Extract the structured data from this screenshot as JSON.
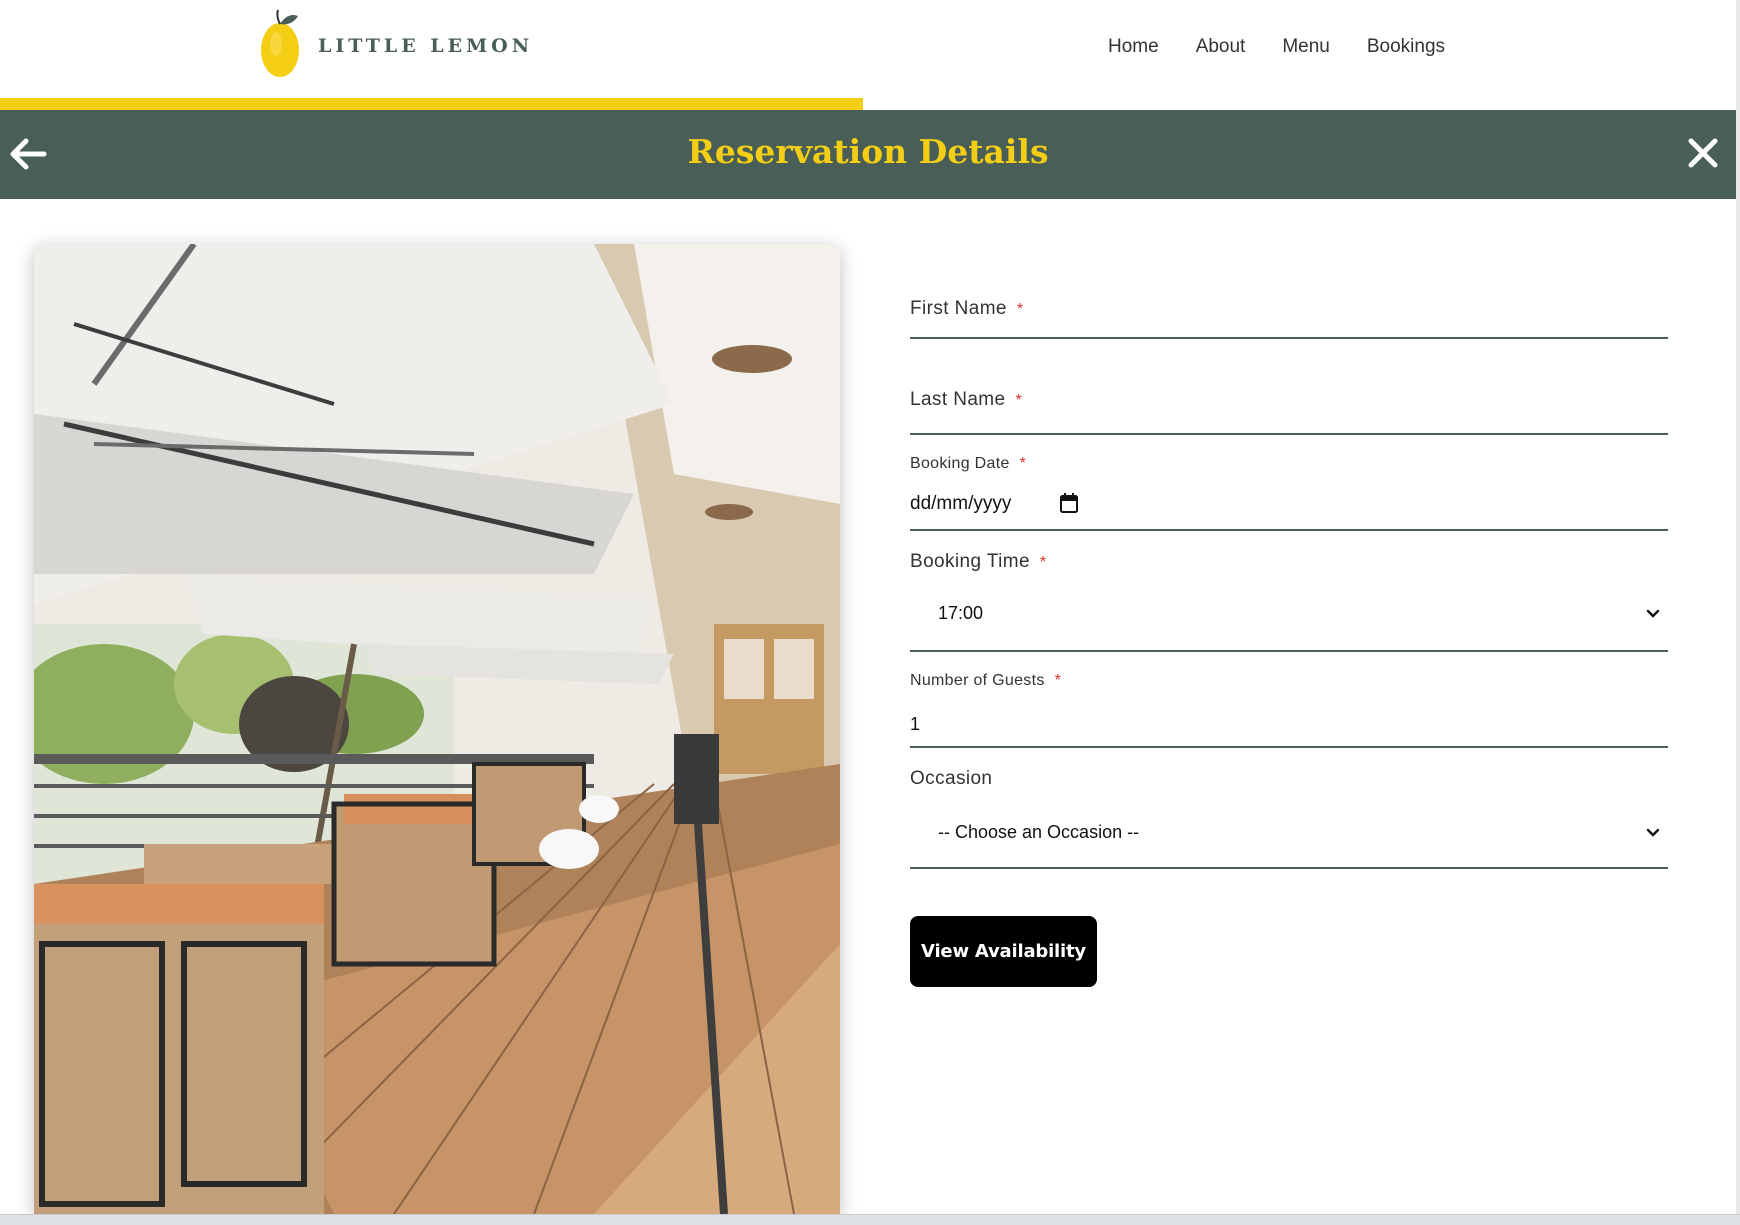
{
  "brand": {
    "name": "LITTLE LEMON",
    "accent_color": "#f4ce14",
    "primary_color": "#495e57"
  },
  "nav": {
    "items": [
      "Home",
      "About",
      "Menu",
      "Bookings"
    ]
  },
  "title_band": {
    "title": "Reservation Details",
    "back_icon": "arrow-left-icon",
    "close_icon": "close-icon"
  },
  "photo": {
    "subject": "restaurant-terrace-photo"
  },
  "form": {
    "required_marker": "*",
    "first_name": {
      "label": "First Name",
      "value": ""
    },
    "last_name": {
      "label": "Last Name",
      "value": ""
    },
    "booking_date": {
      "label": "Booking Date",
      "placeholder": "dd/mm/yyyy",
      "icon": "calendar-icon"
    },
    "booking_time": {
      "label": "Booking Time",
      "value": "17:00"
    },
    "guests": {
      "label": "Number of Guests",
      "value": "1"
    },
    "occasion": {
      "label": "Occasion",
      "value": "-- Choose an Occasion --"
    },
    "submit_label": "View Availability"
  }
}
